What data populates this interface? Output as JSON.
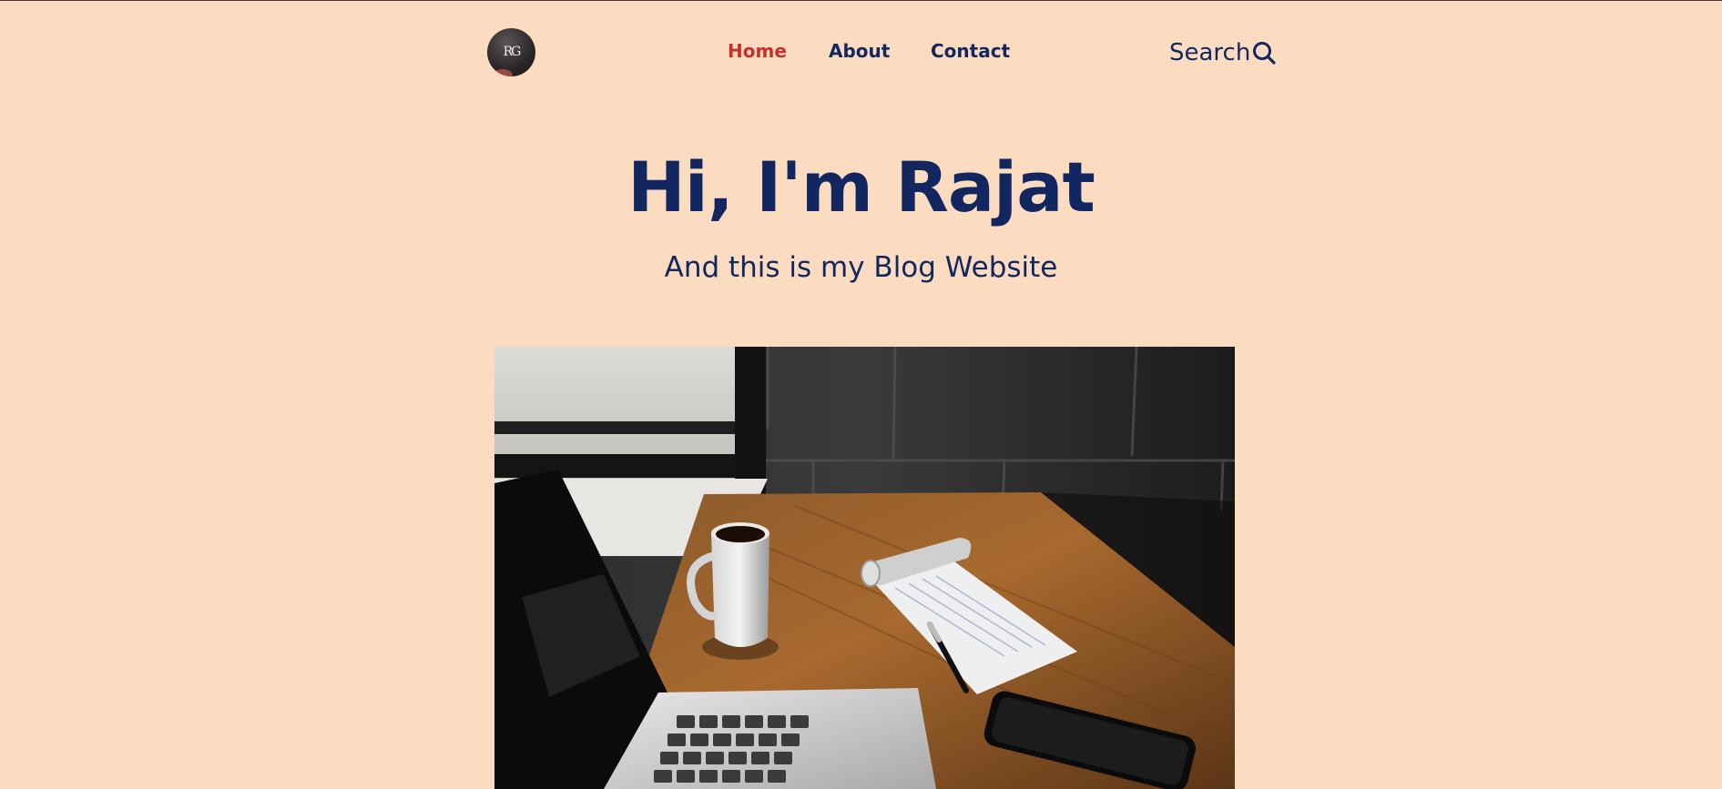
{
  "header": {
    "logo": {
      "initials": "RG",
      "icon": "rg-monogram-logo"
    },
    "nav": [
      {
        "label": "Home",
        "active": true
      },
      {
        "label": "About",
        "active": false
      },
      {
        "label": "Contact",
        "active": false
      }
    ],
    "search": {
      "label": "Search",
      "icon": "search-icon"
    }
  },
  "hero": {
    "title": "Hi, I'm Rajat",
    "subtitle": "And this is my Blog Website",
    "image": {
      "subject": "laptop, coffee mug, notepad with pen and smartphone on a wooden desk",
      "icon": "hero-desk-photo"
    }
  },
  "colors": {
    "background": "#fcdcc0",
    "navy": "#12275f",
    "active": "#c8302c"
  }
}
